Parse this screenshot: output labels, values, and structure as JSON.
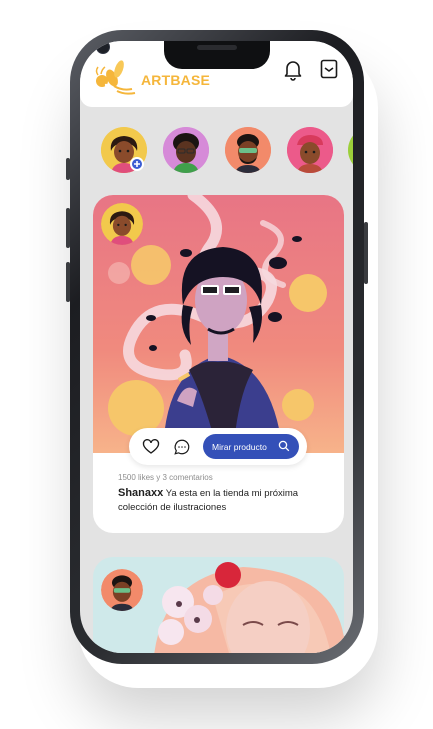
{
  "header": {
    "brand": "ARTBASE",
    "icons": [
      "bee-logo-icon",
      "bell-icon",
      "bookmark-icon"
    ]
  },
  "stories": [
    {
      "name": "story-avatar-add",
      "icon": "add-story-icon"
    },
    {
      "name": "story-avatar-2"
    },
    {
      "name": "story-avatar-3"
    },
    {
      "name": "story-avatar-4"
    },
    {
      "name": "story-avatar-5"
    }
  ],
  "post": {
    "likes_text": "1500 likes y 3 comentarios",
    "author": "Shanaxx",
    "caption": "Ya esta en la tienda mi próxima colección de ilustraciones",
    "cta_label": "Mirar producto",
    "icons": [
      "heart-icon",
      "comment-icon",
      "search-icon"
    ]
  },
  "colors": {
    "brand": "#f5b63b",
    "cta": "#3450b8",
    "background": "#e3e3e3"
  }
}
